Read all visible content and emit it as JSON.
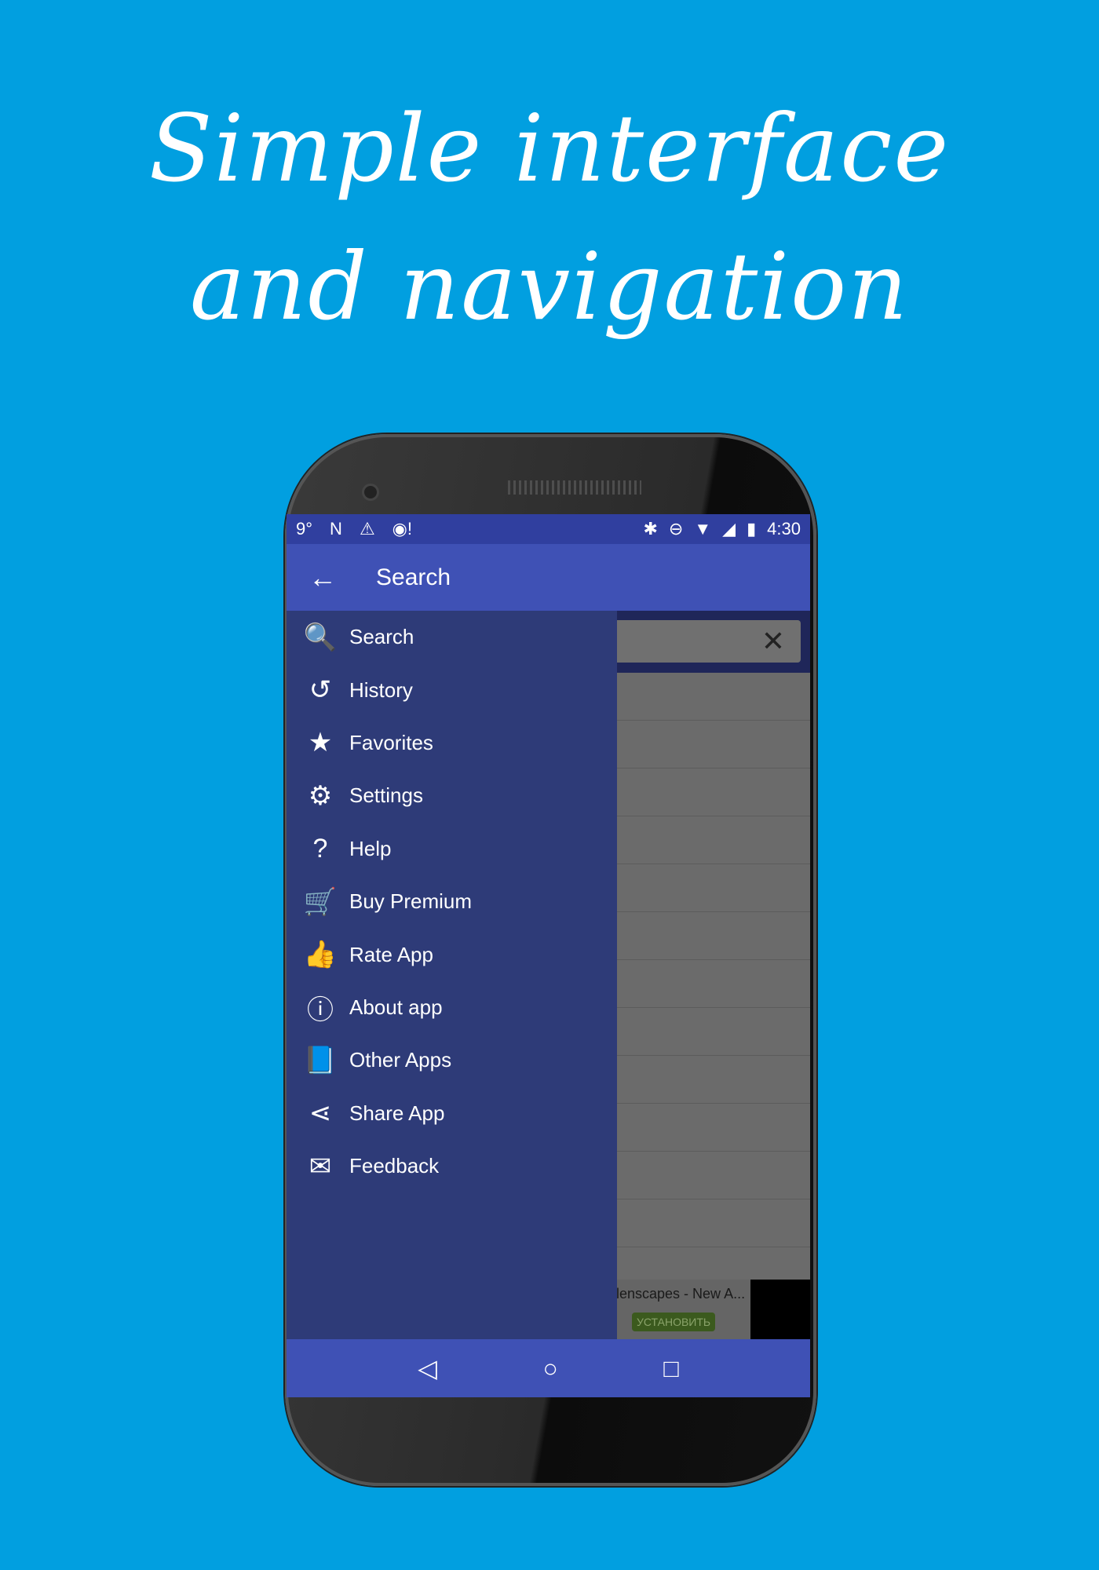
{
  "headline": {
    "line1": "Simple interface",
    "line2": "and navigation"
  },
  "status_bar": {
    "left": [
      "9°",
      "N",
      "⚠",
      "◉!"
    ],
    "right": [
      "✱",
      "⊖",
      "▼",
      "◢",
      "▮"
    ],
    "time": "4:30"
  },
  "toolbar": {
    "title": "Search",
    "back_icon": "arrow-left-icon"
  },
  "search_box": {
    "value": "",
    "clear_icon": "close-icon"
  },
  "drawer": {
    "items": [
      {
        "label": "Search",
        "icon": "🔍"
      },
      {
        "label": "History",
        "icon": "↺"
      },
      {
        "label": "Favorites",
        "icon": "★"
      },
      {
        "label": "Settings",
        "icon": "⚙"
      },
      {
        "label": "Help",
        "icon": "?"
      },
      {
        "label": "Buy Premium",
        "icon": "🛒"
      },
      {
        "label": "Rate App",
        "icon": "👍"
      },
      {
        "label": "About app",
        "icon": "ⓘ"
      },
      {
        "label": "Other Apps",
        "icon": "📘"
      },
      {
        "label": "Share App",
        "icon": "⋖"
      },
      {
        "label": "Feedback",
        "icon": "✉"
      }
    ]
  },
  "ad": {
    "title": "lenscapes - New A...",
    "button": "УСТАНОВИТЬ"
  },
  "nav_bar": {
    "back": "◁",
    "home": "○",
    "recents": "□"
  },
  "colors": {
    "background": "#019FE0",
    "primary": "#3F51B5",
    "primary_dark": "#303F9F",
    "drawer": "#2E3B78"
  }
}
